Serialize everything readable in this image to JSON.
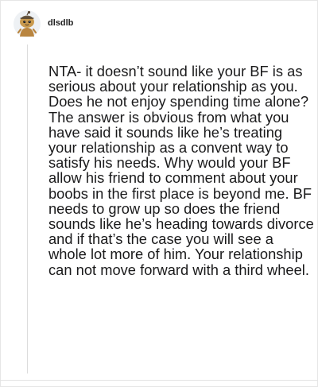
{
  "comment": {
    "username": "dlsdlb",
    "avatar_icon": "reddit-snoo-avatar-icon",
    "body": "NTA- it doesn’t sound like your BF is as serious about your relationship as you. Does he not enjoy spending time alone? The answer is obvious from what you have said it sounds like he’s treating your relationship as a convent way to satisfy his needs. Why would your BF allow his friend to comment about your boobs in the first place is beyond me. BF needs to grow up so does the friend sounds like he’s heading towards divorce and if that’s the case you will see a whole lot more of him. Your relationship can not move forward with a third wheel."
  },
  "colors": {
    "text": "#1a1a1b",
    "thread_line": "#dcdcdc",
    "avatar_fur": "#c99a4e"
  }
}
